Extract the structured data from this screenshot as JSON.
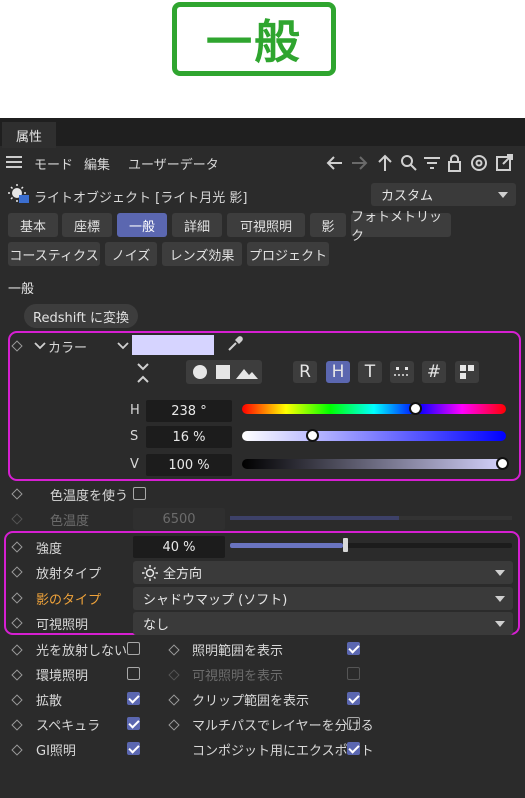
{
  "heading": "一般",
  "window_tab": "属性",
  "menu": {
    "mode": "モード",
    "edit": "編集",
    "user_data": "ユーザーデータ"
  },
  "object": {
    "title": "ライトオブジェクト [ライト月光 影]",
    "preset": "カスタム"
  },
  "tabs": [
    {
      "label": "基本",
      "active": false
    },
    {
      "label": "座標",
      "active": false
    },
    {
      "label": "一般",
      "active": true
    },
    {
      "label": "詳細",
      "active": false
    },
    {
      "label": "可視照明",
      "active": false
    },
    {
      "label": "影",
      "active": false
    },
    {
      "label": "フォトメトリック",
      "active": false
    },
    {
      "label": "コースティクス",
      "active": false
    },
    {
      "label": "ノイズ",
      "active": false
    },
    {
      "label": "レンズ効果",
      "active": false
    },
    {
      "label": "プロジェクト",
      "active": false
    }
  ],
  "section": {
    "title": "一般",
    "convert_button": "Redshift に変換"
  },
  "color": {
    "label": "カラー",
    "swatch": "#d6d4ff",
    "mode_buttons": [
      "R",
      "H",
      "T",
      "#"
    ],
    "h_label": "H",
    "h_value": "238 °",
    "h_level": 0.66,
    "s_label": "S",
    "s_value": "16 %",
    "s_level": 0.16,
    "v_label": "V",
    "v_value": "100 %",
    "v_level": 1.0
  },
  "temperature": {
    "use_label": "色温度を使う",
    "label": "色温度",
    "value": "6500",
    "level": 0.6
  },
  "intensity": {
    "label": "強度",
    "value": "40 %",
    "level": 0.4
  },
  "emission": {
    "label": "放射タイプ",
    "value": "全方向"
  },
  "shadow": {
    "label": "影のタイプ",
    "value": "シャドウマップ (ソフト)"
  },
  "visible": {
    "label": "可視照明",
    "value": "なし"
  },
  "options_left": [
    {
      "label": "光を放射しない",
      "checked": false
    },
    {
      "label": "環境照明",
      "checked": false
    },
    {
      "label": "拡散",
      "checked": true
    },
    {
      "label": "スペキュラ",
      "checked": true
    },
    {
      "label": "GI照明",
      "checked": true
    }
  ],
  "options_right": [
    {
      "label": "照明範囲を表示",
      "checked": true
    },
    {
      "label": "可視照明を表示",
      "checked": false
    },
    {
      "label": "クリップ範囲を表示",
      "checked": true
    },
    {
      "label": "マルチパスでレイヤーを分ける",
      "checked": false
    },
    {
      "label": "コンポジット用にエクスポート",
      "checked": true
    }
  ],
  "colors": {
    "accent": "#5b67b0",
    "highlight": "#d61fd2",
    "label_orange": "#f0a33a",
    "heading_green": "#2fa52f"
  }
}
